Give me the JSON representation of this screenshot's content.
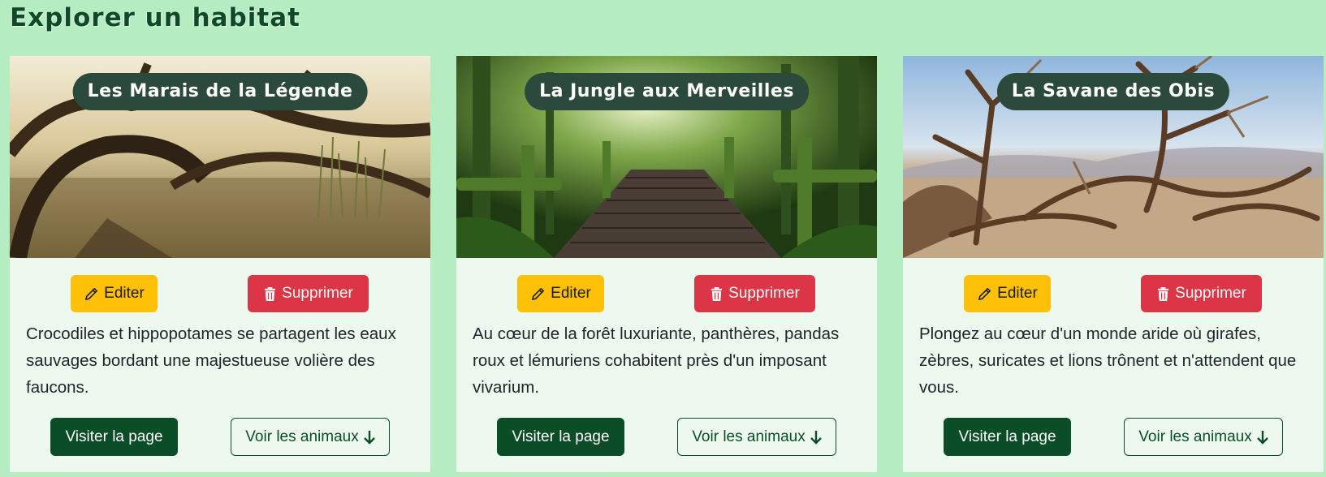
{
  "page": {
    "title": "Explorer un habitat"
  },
  "actions": {
    "edit_label": "Editer",
    "delete_label": "Supprimer",
    "visit_label": "Visiter la page",
    "animals_label": "Voir les animaux"
  },
  "colors": {
    "background": "#b5ecc1",
    "card": "#edf9ee",
    "edit": "#ffc107",
    "delete": "#dc3545",
    "primary": "#0b4d27",
    "name_badge": "#2b4a3c"
  },
  "habitats": [
    {
      "name": "Les Marais de la Légende",
      "description": "Crocodiles et hippopotames se partagent les eaux sauvages bordant une majestueuse volière des faucons.",
      "image": "swamp-photo"
    },
    {
      "name": "La Jungle aux Merveilles",
      "description": "Au cœur de la forêt luxuriante, panthères, pandas roux et lémuriens cohabitent près d'un imposant vivarium.",
      "image": "jungle-photo"
    },
    {
      "name": "La Savane des Obis",
      "description": "Plongez au cœur d'un monde aride où girafes, zèbres, suricates et lions trônent et n'attendent que vous.",
      "image": "savanna-photo"
    }
  ]
}
